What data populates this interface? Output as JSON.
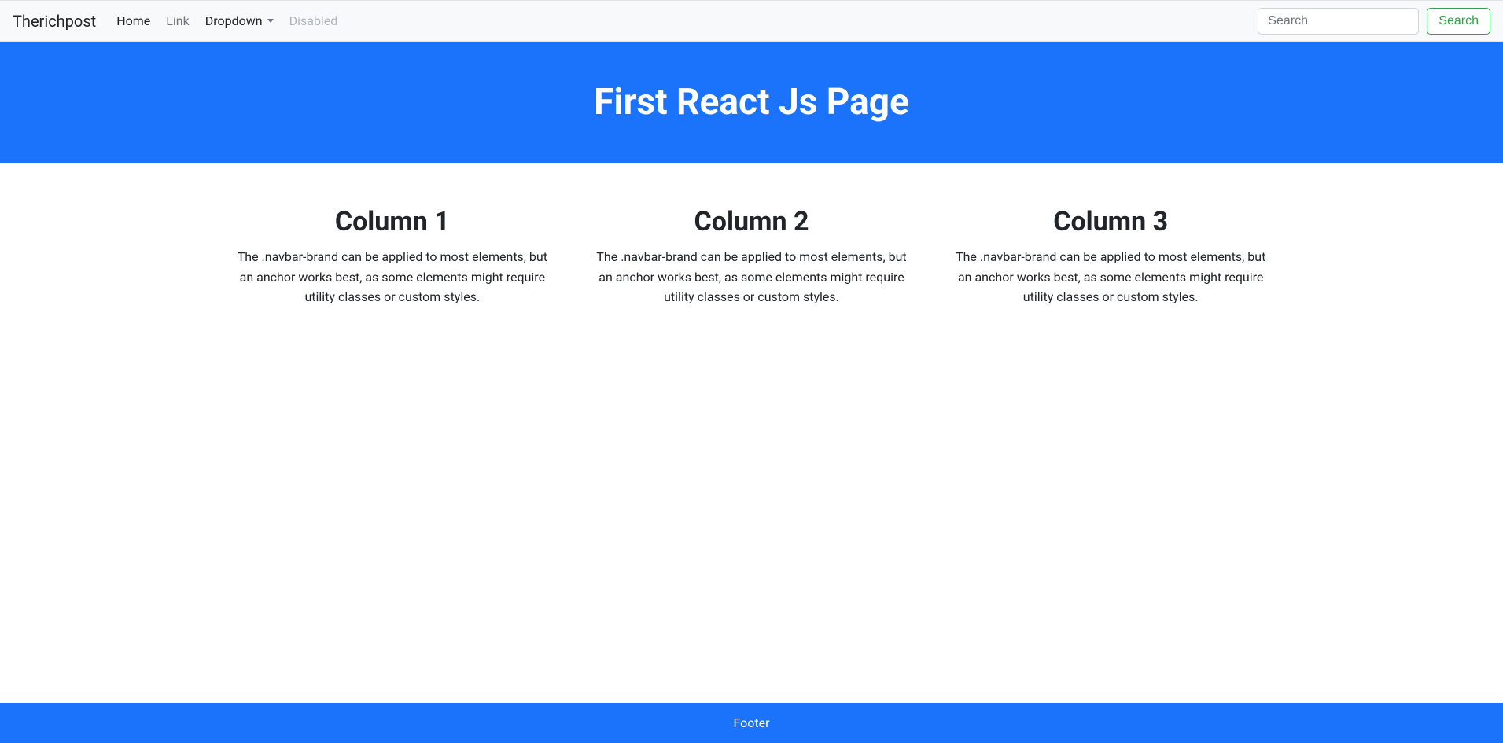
{
  "navbar": {
    "brand": "Therichpost",
    "home_label": "Home",
    "link_label": "Link",
    "dropdown_label": "Dropdown",
    "disabled_label": "Disabled",
    "search_placeholder": "Search",
    "search_button": "Search"
  },
  "jumbotron": {
    "title": "First React Js Page"
  },
  "columns": [
    {
      "title": "Column 1",
      "text": "The .navbar-brand can be applied to most elements, but an anchor works best, as some elements might require utility classes or custom styles."
    },
    {
      "title": "Column 2",
      "text": "The .navbar-brand can be applied to most elements, but an anchor works best, as some elements might require utility classes or custom styles."
    },
    {
      "title": "Column 3",
      "text": "The .navbar-brand can be applied to most elements, but an anchor works best, as some elements might require utility classes or custom styles."
    }
  ],
  "footer": {
    "text": "Footer"
  }
}
